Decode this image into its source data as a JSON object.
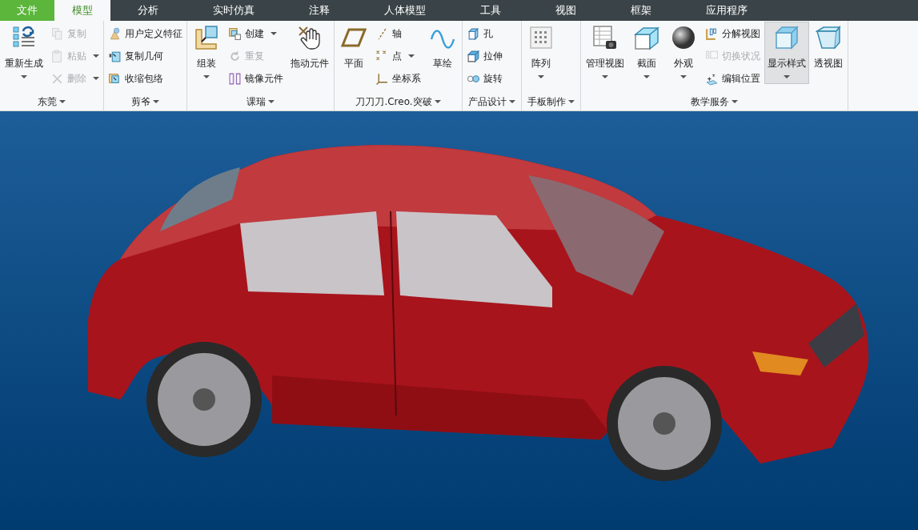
{
  "tabs": [
    {
      "label": "文件",
      "kind": "file",
      "selected": false
    },
    {
      "label": "模型",
      "kind": "tab",
      "selected": true
    },
    {
      "label": "分析",
      "kind": "tab",
      "selected": false
    },
    {
      "label": "实时仿真",
      "kind": "tab",
      "selected": false
    },
    {
      "label": "注释",
      "kind": "tab",
      "selected": false
    },
    {
      "label": "人体模型",
      "kind": "tab",
      "selected": false
    },
    {
      "label": "工具",
      "kind": "tab",
      "selected": false
    },
    {
      "label": "视图",
      "kind": "tab",
      "selected": false
    },
    {
      "label": "框架",
      "kind": "tab",
      "selected": false
    },
    {
      "label": "应用程序",
      "kind": "tab",
      "selected": false
    }
  ],
  "ribbon": {
    "groups": [
      {
        "label": "东莞",
        "columns": [
          {
            "kind": "large",
            "buttons": [
              {
                "label": "重新生成",
                "dropdown": true,
                "disabled": false,
                "pressed": false
              }
            ]
          },
          {
            "kind": "stack",
            "buttons": [
              {
                "label": "复制",
                "dropdown": false,
                "disabled": true,
                "pressed": false
              },
              {
                "label": "粘贴",
                "dropdown": true,
                "disabled": true,
                "pressed": false
              },
              {
                "label": "删除",
                "dropdown": true,
                "disabled": true,
                "pressed": false
              }
            ]
          }
        ]
      },
      {
        "label": "剪爷",
        "columns": [
          {
            "kind": "stack",
            "buttons": [
              {
                "label": "用户定义特征",
                "dropdown": false,
                "disabled": false,
                "pressed": false
              },
              {
                "label": "复制几何",
                "dropdown": false,
                "disabled": false,
                "pressed": false
              },
              {
                "label": "收缩包络",
                "dropdown": false,
                "disabled": false,
                "pressed": false
              }
            ]
          }
        ]
      },
      {
        "label": "课瑞",
        "columns": [
          {
            "kind": "large",
            "buttons": [
              {
                "label": "组装",
                "dropdown": true,
                "disabled": false,
                "pressed": false
              }
            ]
          },
          {
            "kind": "stack",
            "buttons": [
              {
                "label": "创建",
                "dropdown": true,
                "disabled": false,
                "pressed": false
              },
              {
                "label": "重复",
                "dropdown": false,
                "disabled": true,
                "pressed": false
              },
              {
                "label": "镜像元件",
                "dropdown": false,
                "disabled": false,
                "pressed": false
              }
            ]
          },
          {
            "kind": "large",
            "buttons": [
              {
                "label": "拖动元件",
                "dropdown": false,
                "disabled": false,
                "pressed": false
              }
            ]
          }
        ]
      },
      {
        "label": "刀刀刀.Creo.突破",
        "columns": [
          {
            "kind": "large",
            "buttons": [
              {
                "label": "平面",
                "dropdown": false,
                "disabled": false,
                "pressed": false
              }
            ]
          },
          {
            "kind": "stack",
            "buttons": [
              {
                "label": "轴",
                "dropdown": false,
                "disabled": false,
                "pressed": false
              },
              {
                "label": "点",
                "dropdown": true,
                "disabled": false,
                "pressed": false
              },
              {
                "label": "坐标系",
                "dropdown": false,
                "disabled": false,
                "pressed": false
              }
            ]
          },
          {
            "kind": "large",
            "buttons": [
              {
                "label": "草绘",
                "dropdown": false,
                "disabled": false,
                "pressed": false
              }
            ]
          }
        ]
      },
      {
        "label": "产品设计",
        "columns": [
          {
            "kind": "stack",
            "buttons": [
              {
                "label": "孔",
                "dropdown": false,
                "disabled": false,
                "pressed": false
              },
              {
                "label": "拉伸",
                "dropdown": false,
                "disabled": false,
                "pressed": false
              },
              {
                "label": "旋转",
                "dropdown": false,
                "disabled": false,
                "pressed": false
              }
            ]
          }
        ]
      },
      {
        "label": "手板制作",
        "columns": [
          {
            "kind": "large",
            "buttons": [
              {
                "label": "阵列",
                "dropdown": true,
                "disabled": false,
                "pressed": false
              }
            ]
          }
        ]
      },
      {
        "label": "教学服务",
        "columns": [
          {
            "kind": "large",
            "buttons": [
              {
                "label": "管理视图",
                "dropdown": true,
                "disabled": false,
                "pressed": false
              }
            ]
          },
          {
            "kind": "large",
            "buttons": [
              {
                "label": "截面",
                "dropdown": true,
                "disabled": false,
                "pressed": false
              }
            ]
          },
          {
            "kind": "large",
            "buttons": [
              {
                "label": "外观",
                "dropdown": true,
                "disabled": false,
                "pressed": false
              }
            ]
          },
          {
            "kind": "stack",
            "buttons": [
              {
                "label": "分解视图",
                "dropdown": false,
                "disabled": false,
                "pressed": false
              },
              {
                "label": "切换状况",
                "dropdown": false,
                "disabled": true,
                "pressed": false
              },
              {
                "label": "编辑位置",
                "dropdown": false,
                "disabled": false,
                "pressed": false
              }
            ]
          },
          {
            "kind": "large",
            "buttons": [
              {
                "label": "显示样式",
                "dropdown": true,
                "disabled": false,
                "pressed": true
              }
            ]
          },
          {
            "kind": "large",
            "buttons": [
              {
                "label": "透视图",
                "dropdown": false,
                "disabled": false,
                "pressed": false
              }
            ]
          }
        ]
      }
    ]
  }
}
